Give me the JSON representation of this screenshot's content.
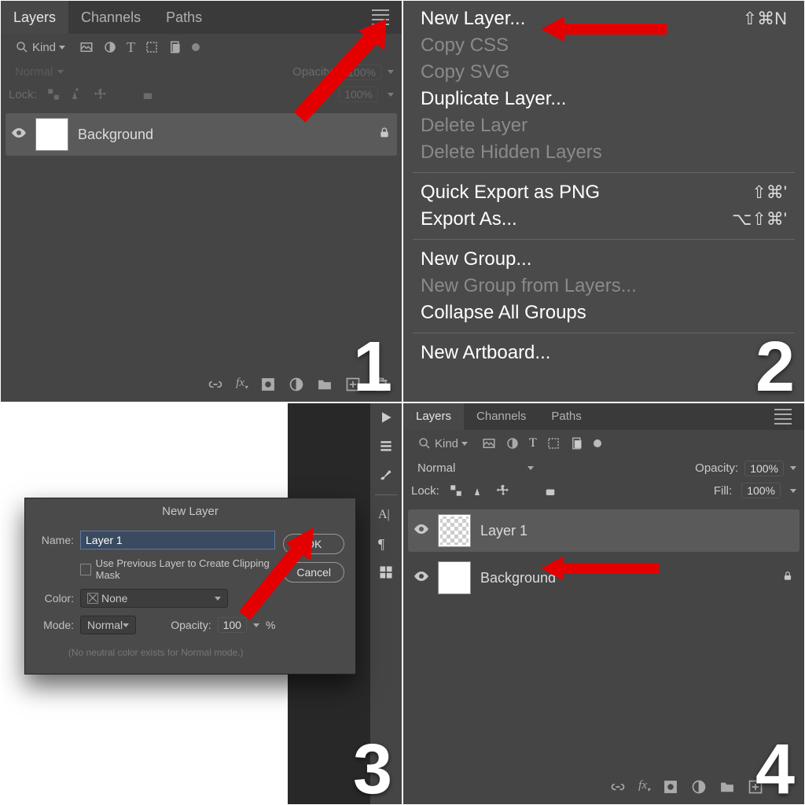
{
  "panel": {
    "tabs": [
      "Layers",
      "Channels",
      "Paths"
    ],
    "filterLabel": "Kind",
    "blendMode": "Normal",
    "opacityLabel": "Opacity:",
    "opacityValue": "100%",
    "fillLabel": "Fill:",
    "fillValue": "100%",
    "lockLabel": "Lock:"
  },
  "q1": {
    "layer": "Background"
  },
  "q2": {
    "items": [
      {
        "t": "New Layer...",
        "sc": "⇧⌘N",
        "dis": false
      },
      {
        "t": "Copy CSS",
        "dis": true
      },
      {
        "t": "Copy SVG",
        "dis": true
      },
      {
        "t": "Duplicate Layer...",
        "dis": false
      },
      {
        "t": "Delete Layer",
        "dis": true
      },
      {
        "t": "Delete Hidden Layers",
        "dis": true
      },
      {
        "sep": true
      },
      {
        "t": "Quick Export as PNG",
        "sc": "⇧⌘'",
        "dis": false
      },
      {
        "t": "Export As...",
        "sc": "⌥⇧⌘'",
        "dis": false
      },
      {
        "sep": true
      },
      {
        "t": "New Group...",
        "dis": false
      },
      {
        "t": "New Group from Layers...",
        "dis": true
      },
      {
        "t": "Collapse All Groups",
        "dis": false
      },
      {
        "sep": true
      },
      {
        "t": "New Artboard...",
        "dis": false
      }
    ]
  },
  "q3": {
    "title": "New Layer",
    "nameLabel": "Name:",
    "nameValue": "Layer 1",
    "clipLabel": "Use Previous Layer to Create Clipping Mask",
    "colorLabel": "Color:",
    "colorValue": "None",
    "modeLabel": "Mode:",
    "modeValue": "Normal",
    "opacityLabel": "Opacity:",
    "opacityValue": "100",
    "opacityUnit": "%",
    "hint": "(No neutral color exists for Normal mode.)",
    "ok": "OK",
    "cancel": "Cancel"
  },
  "q4": {
    "layer1": "Layer 1",
    "bg": "Background"
  },
  "steps": {
    "s1": "1",
    "s2": "2",
    "s3": "3",
    "s4": "4"
  }
}
